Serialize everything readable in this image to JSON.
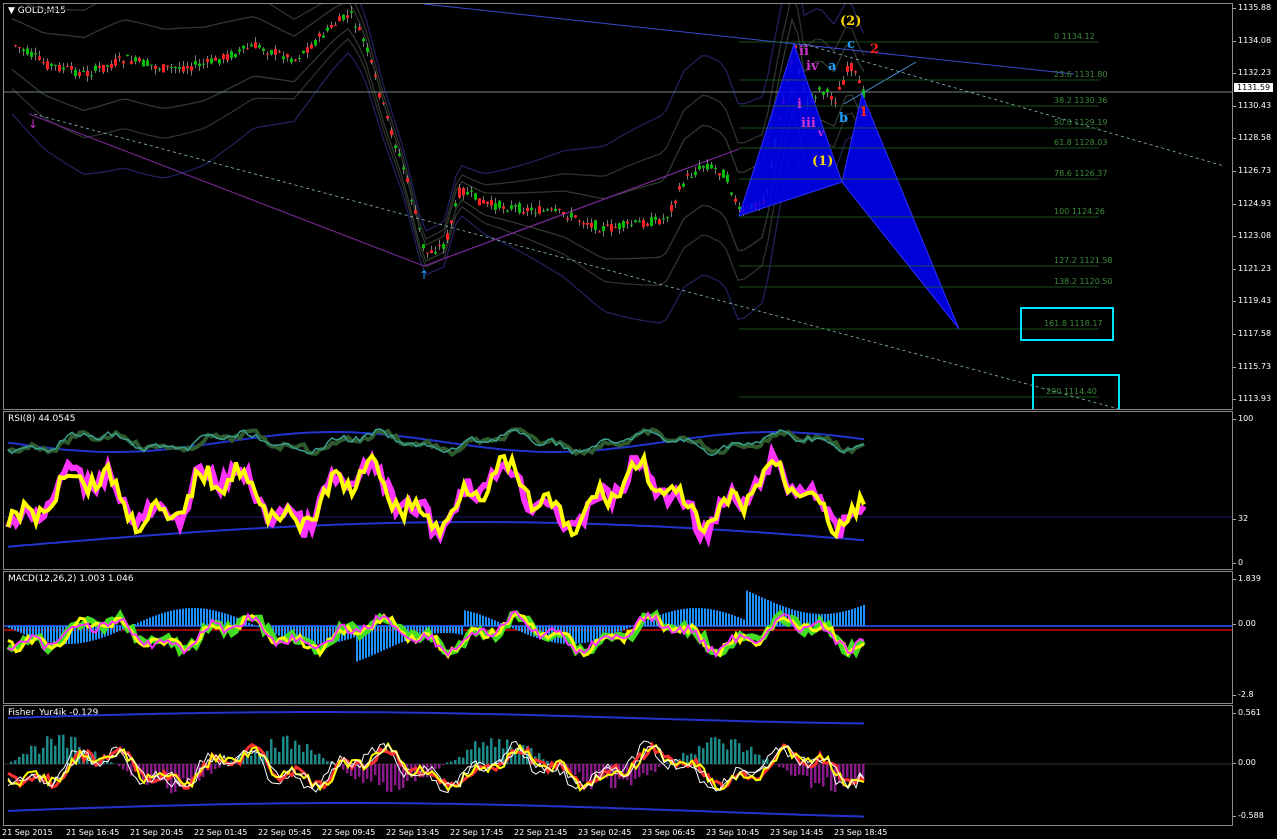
{
  "symbol_label": "GOLD,M15",
  "current_price": "1131.59",
  "price_axis": [
    "1135.88",
    "1134.08",
    "1132.23",
    "1130.43",
    "1128.58",
    "1126.73",
    "1124.93",
    "1123.08",
    "1121.23",
    "1119.43",
    "1117.58",
    "1115.73",
    "1113.93"
  ],
  "fib_levels": [
    "0 1134.12",
    "23.6 1131.80",
    "38.2 1130.36",
    "50.0 1129.19",
    "61.8 1128.03",
    "78.6 1126.37",
    "100 1124.26",
    "127.2 1121.58",
    "138.2 1120.50",
    "161.8 1118.17",
    "200 1114.40"
  ],
  "wave_labels": {
    "w2_big": "(2)",
    "w1_big": "(1)",
    "ii": "ii",
    "iv": "iv",
    "i": "i",
    "iii": "iii",
    "v": "v",
    "a": "a",
    "b": "b",
    "c": "c",
    "n1": "1",
    "n2": "2"
  },
  "rsi": {
    "title": "RSI(8) 44.0545",
    "axis": [
      "100",
      "32",
      "0"
    ]
  },
  "macd": {
    "title": "MACD(12,26,2) 1.003 1.046",
    "axis": [
      "1.839",
      "0.00",
      "-2.8"
    ]
  },
  "fisher": {
    "title": "Fisher_Yur4ik -0.129",
    "axis": [
      "0.561",
      "0.00",
      "-0.588"
    ]
  },
  "time_axis": [
    "21 Sep 2015",
    "21 Sep 16:45",
    "21 Sep 20:45",
    "22 Sep 01:45",
    "22 Sep 05:45",
    "22 Sep 09:45",
    "22 Sep 13:45",
    "22 Sep 17:45",
    "22 Sep 21:45",
    "23 Sep 02:45",
    "23 Sep 06:45",
    "23 Sep 10:45",
    "23 Sep 14:45",
    "23 Sep 18:45"
  ],
  "colors": {
    "bull": "#00c000",
    "bear": "#ff2020",
    "rsi": "#ffff00",
    "macd_hist": "#1e90ff",
    "harmonic": "#0000ff",
    "box": "#00e5ff"
  }
}
